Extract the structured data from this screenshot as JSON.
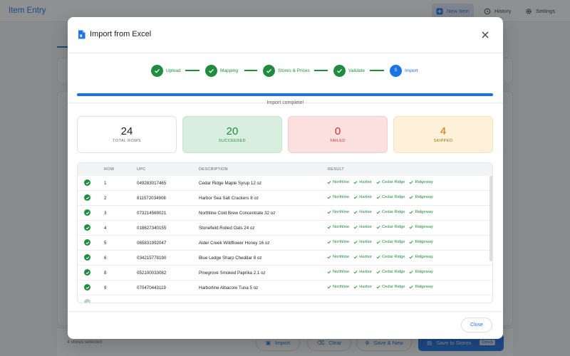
{
  "app": {
    "title": "Item Entry",
    "header_buttons": [
      {
        "label": "New Item",
        "icon": "plus-square-icon"
      },
      {
        "label": "History",
        "icon": "history-icon"
      },
      {
        "label": "Settings",
        "icon": "gear-icon"
      }
    ],
    "footer": {
      "selected_text": "4 stores selected",
      "import_label": "Import",
      "clear_label": "Clear",
      "save_new_label": "Save & New",
      "save_stores_label": "Save to Stores",
      "shortcut": "Ctrl+S"
    }
  },
  "modal": {
    "title": "Import from Excel",
    "title_icon": "excel-file-icon",
    "close_label": "Close",
    "steps": [
      {
        "label": "Upload",
        "state": "done"
      },
      {
        "label": "Mapping",
        "state": "done"
      },
      {
        "label": "Stores & Prices",
        "state": "done"
      },
      {
        "label": "Validate",
        "state": "done"
      },
      {
        "label": "Import",
        "state": "active",
        "number": "5"
      }
    ],
    "progress": {
      "fraction": 1.0,
      "text": "Import complete!"
    },
    "stats": {
      "total": {
        "value": "24",
        "label": "TOTAL ROWS"
      },
      "succeeded": {
        "value": "20",
        "label": "SUCCEEDED"
      },
      "failed": {
        "value": "0",
        "label": "FAILED"
      },
      "skipped": {
        "value": "4",
        "label": "SKIPPED"
      }
    },
    "table": {
      "headers": {
        "row": "ROW",
        "upc": "UPC",
        "description": "DESCRIPTION",
        "result": "RESULT"
      },
      "rows": [
        {
          "row": "1",
          "upc": "049283017465",
          "description": "Cedar Ridge Maple Syrup 12 oz"
        },
        {
          "row": "2",
          "upc": "811572034908",
          "description": "Harbor Sea Salt Crackers 8 oz"
        },
        {
          "row": "3",
          "upc": "073214569021",
          "description": "Northline Cold Brew Concentrate 32 oz"
        },
        {
          "row": "4",
          "upc": "018627340155",
          "description": "Stonefield Rolled Oats 24 oz"
        },
        {
          "row": "5",
          "upc": "065831992047",
          "description": "Alder Creek Wildflower Honey 16 oz"
        },
        {
          "row": "6",
          "upc": "034215778190",
          "description": "Blue Ledge Sharp Cheddar 8 oz"
        },
        {
          "row": "8",
          "upc": "052100033082",
          "description": "Pinegrove Smoked Paprika 2.1 oz"
        },
        {
          "row": "9",
          "upc": "070470443119",
          "description": "Harborline Albacore Tuna 5 oz"
        }
      ],
      "result_stores": [
        "Northline",
        "Harbor",
        "Cedar Ridge",
        "Ridgeway"
      ],
      "status_color": "#1e8e3e"
    }
  },
  "colors": {
    "accent": "#1a73e8",
    "success": "#1e8e3e",
    "danger": "#d93025",
    "warning": "#e37400"
  }
}
